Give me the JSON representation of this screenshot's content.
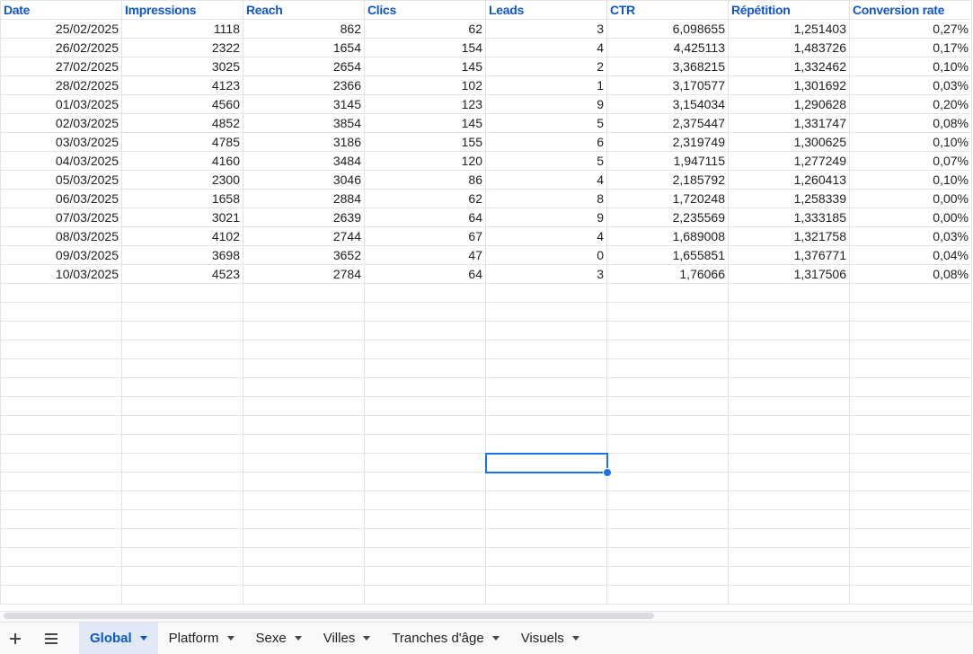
{
  "sheet": {
    "headers": [
      "Date",
      "Impressions",
      "Reach",
      "Clics",
      "Leads",
      "CTR",
      "Répétition",
      "Conversion rate"
    ],
    "rows": [
      [
        "25/02/2025",
        "1118",
        "862",
        "62",
        "3",
        "6,098655",
        "1,251403",
        "0,27%"
      ],
      [
        "26/02/2025",
        "2322",
        "1654",
        "154",
        "4",
        "4,425113",
        "1,483726",
        "0,17%"
      ],
      [
        "27/02/2025",
        "3025",
        "2654",
        "145",
        "2",
        "3,368215",
        "1,332462",
        "0,10%"
      ],
      [
        "28/02/2025",
        "4123",
        "2366",
        "102",
        "1",
        "3,170577",
        "1,301692",
        "0,03%"
      ],
      [
        "01/03/2025",
        "4560",
        "3145",
        "123",
        "9",
        "3,154034",
        "1,290628",
        "0,20%"
      ],
      [
        "02/03/2025",
        "4852",
        "3854",
        "145",
        "5",
        "2,375447",
        "1,331747",
        "0,08%"
      ],
      [
        "03/03/2025",
        "4785",
        "3186",
        "155",
        "6",
        "2,319749",
        "1,300625",
        "0,10%"
      ],
      [
        "04/03/2025",
        "4160",
        "3484",
        "120",
        "5",
        "1,947115",
        "1,277249",
        "0,07%"
      ],
      [
        "05/03/2025",
        "2300",
        "3046",
        "86",
        "4",
        "2,185792",
        "1,260413",
        "0,10%"
      ],
      [
        "06/03/2025",
        "1658",
        "2884",
        "62",
        "8",
        "1,720248",
        "1,258339",
        "0,00%"
      ],
      [
        "07/03/2025",
        "3021",
        "2639",
        "64",
        "9",
        "2,235569",
        "1,333185",
        "0,00%"
      ],
      [
        "08/03/2025",
        "4102",
        "2744",
        "67",
        "4",
        "1,689008",
        "1,321758",
        "0,03%"
      ],
      [
        "09/03/2025",
        "3698",
        "3652",
        "47",
        "0",
        "1,655851",
        "1,376771",
        "0,04%"
      ],
      [
        "10/03/2025",
        "4523",
        "2784",
        "64",
        "3",
        "1,76066",
        "1,317506",
        "0,08%"
      ]
    ],
    "empty_rows": 17,
    "selected_cell": {
      "empty_row": 9,
      "col": 4
    }
  },
  "tabs": {
    "add_icon": "plus-icon",
    "list_icon": "menu-icon",
    "items": [
      {
        "label": "Global",
        "active": true
      },
      {
        "label": "Platform",
        "active": false
      },
      {
        "label": "Sexe",
        "active": false
      },
      {
        "label": "Villes",
        "active": false
      },
      {
        "label": "Tranches d'âge",
        "active": false
      },
      {
        "label": "Visuels",
        "active": false
      }
    ]
  },
  "colors": {
    "header_text": "#1155cc",
    "selection": "#1a73e8",
    "active_tab_bg": "#e1e9f7"
  }
}
